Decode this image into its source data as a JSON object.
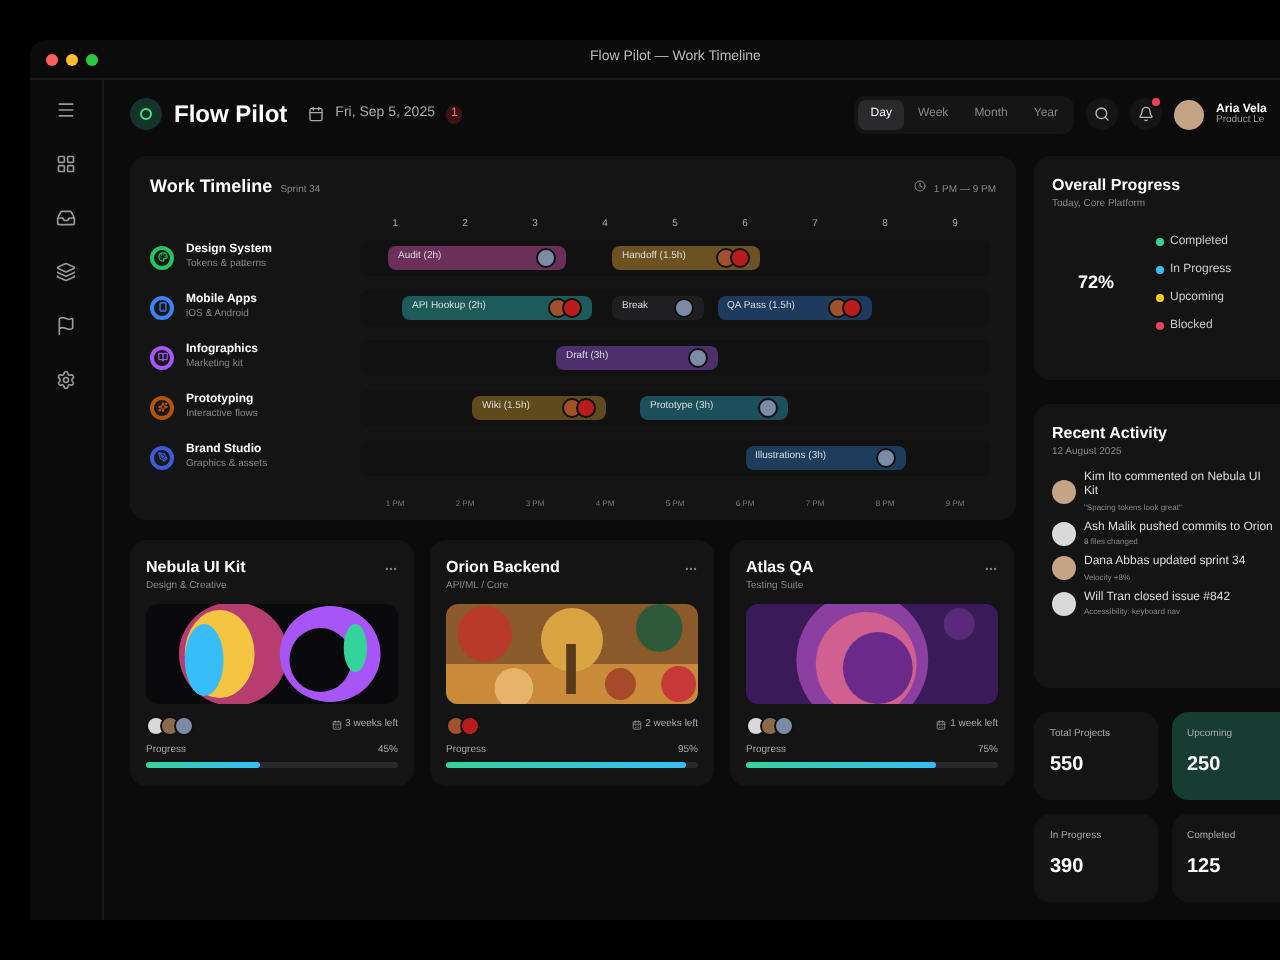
{
  "window": {
    "title": "Flow Pilot — Work Timeline"
  },
  "header": {
    "app_name": "Flow Pilot",
    "date": "Fri, Sep 5, 2025",
    "badge": "1",
    "ranges": [
      {
        "label": "Day",
        "selected": true
      },
      {
        "label": "Week",
        "selected": false
      },
      {
        "label": "Month",
        "selected": false
      },
      {
        "label": "Year",
        "selected": false
      }
    ],
    "notifications": true,
    "user": {
      "name": "Aria Vela",
      "role": "Product Le"
    }
  },
  "timeline": {
    "title": "Work Timeline",
    "subtitle": "Sprint 34",
    "range": "1 PM — 9 PM",
    "columns": [
      "1",
      "2",
      "3",
      "4",
      "5",
      "6",
      "7",
      "8",
      "9"
    ],
    "hours": [
      "1 PM",
      "2 PM",
      "3 PM",
      "4 PM",
      "5 PM",
      "6 PM",
      "7 PM",
      "8 PM",
      "9 PM"
    ],
    "rows": [
      {
        "name": "Design System",
        "detail": "Tokens & patterns",
        "color": "#22c55e",
        "bars": [
          {
            "label": "Audit (2h)",
            "color": "#6b2f5a"
          },
          {
            "label": "Handoff (1.5h)",
            "color": "#6b5220"
          }
        ]
      },
      {
        "name": "Mobile Apps",
        "detail": "iOS & Android",
        "color": "#3b82f6",
        "bars": [
          {
            "label": "API Hookup (2h)",
            "color": "#1d5a5a"
          },
          {
            "label": "Break",
            "color": "#1f1f22"
          },
          {
            "label": "QA Pass (1.5h)",
            "color": "#1e3a5f"
          }
        ]
      },
      {
        "name": "Infographics",
        "detail": "Marketing kit",
        "color": "#a855f7",
        "bars": [
          {
            "label": "Draft (3h)",
            "color": "#4c2f6b"
          }
        ]
      },
      {
        "name": "Prototyping",
        "detail": "Interactive flows",
        "color": "#b45309",
        "bars": [
          {
            "label": "Wiki (1.5h)",
            "color": "#5f4a1c"
          },
          {
            "label": "Prototype (3h)",
            "color": "#1c4f5c"
          }
        ]
      },
      {
        "name": "Brand Studio",
        "detail": "Graphics & assets",
        "color": "#3b5bdb",
        "bars": [
          {
            "label": "Illustrations (3h)",
            "color": "#1e3d5c"
          }
        ]
      }
    ]
  },
  "projects": [
    {
      "title": "Nebula UI Kit",
      "subtitle": "Design & Creative",
      "due": "3 weeks left",
      "progress_label": "Progress",
      "progress": "45%",
      "level": 0.45
    },
    {
      "title": "Orion Backend",
      "subtitle": "API/ML / Core",
      "due": "2 weeks left",
      "progress_label": "Progress",
      "progress": "95%",
      "level": 0.95
    },
    {
      "title": "Atlas QA",
      "subtitle": "Testing Suite",
      "due": "1 week left",
      "progress_label": "Progress",
      "progress": "75%",
      "level": 0.75
    }
  ],
  "overall": {
    "title": "Overall Progress",
    "subtitle": "Today, Core Platform",
    "percent": "72%",
    "legend": [
      {
        "label": "Completed",
        "color": "#34d399"
      },
      {
        "label": "In Progress",
        "color": "#38bdf8"
      },
      {
        "label": "Upcoming",
        "color": "#facc15"
      },
      {
        "label": "Blocked",
        "color": "#f43f5e"
      }
    ]
  },
  "activity": {
    "title": "Recent Activity",
    "date": "12 August 2025",
    "items": [
      {
        "text": "Kim Ito commented on Nebula UI Kit",
        "detail": "\"Spacing tokens look great\""
      },
      {
        "text": "Ash Malik pushed commits to Orion",
        "detail": "8 files changed"
      },
      {
        "text": "Dana Abbas updated sprint 34",
        "detail": "Velocity +8%"
      },
      {
        "text": "Will Tran closed issue #842",
        "detail": "Accessibility: keyboard nav"
      }
    ]
  },
  "stats": [
    {
      "label": "Total Projects",
      "value": "550",
      "selected": false
    },
    {
      "label": "Upcoming",
      "value": "250",
      "selected": true
    },
    {
      "label": "In Progress",
      "value": "390",
      "selected": false
    },
    {
      "label": "Completed",
      "value": "125",
      "selected": false
    }
  ]
}
